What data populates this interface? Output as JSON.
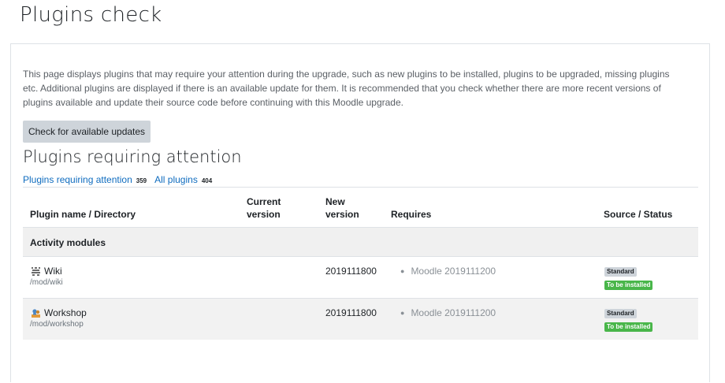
{
  "page": {
    "title": "Plugins check"
  },
  "intro": "This page displays plugins that may require your attention during the upgrade, such as new plugins to be installed, plugins to be upgraded, missing plugins etc. Additional plugins are displayed if there is an available update for them. It is recommended that you check whether there are more recent versions of plugins available and update their source code before continuing with this Moodle upgrade.",
  "check_button": "Check for available updates",
  "section_heading": "Plugins requiring attention",
  "filters": [
    {
      "label": "Plugins requiring attention",
      "count": "359"
    },
    {
      "label": "All plugins",
      "count": "404"
    }
  ],
  "table": {
    "headers": {
      "name": "Plugin name / Directory",
      "current_1": "Current",
      "current_2": "version",
      "new_1": "New",
      "new_2": "version",
      "requires": "Requires",
      "source": "Source / Status"
    },
    "group": "Activity modules",
    "rows": [
      {
        "icon": "wiki-icon",
        "name": "Wiki",
        "dir": "/mod/wiki",
        "current": "",
        "new": "2019111800",
        "requires": "Moodle 2019111200",
        "source": "Standard",
        "status": "To be installed"
      },
      {
        "icon": "workshop-icon",
        "name": "Workshop",
        "dir": "/mod/workshop",
        "current": "",
        "new": "2019111800",
        "requires": "Moodle 2019111200",
        "source": "Standard",
        "status": "To be installed"
      }
    ]
  },
  "colors": {
    "link": "#0f6cbf",
    "success": "#49b64a",
    "button": "#ced4da",
    "group_bg": "#f0f0f0"
  }
}
